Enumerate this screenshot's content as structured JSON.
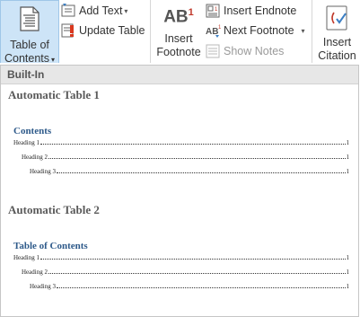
{
  "ribbon": {
    "toc_button": {
      "line1": "Table of",
      "line2": "Contents",
      "arrow": "▾",
      "icon": "document-lines-icon"
    },
    "add_text": {
      "label": "Add Text",
      "arrow": "▾",
      "icon": "add-text-icon"
    },
    "update_table": {
      "label": "Update Table",
      "icon": "update-table-icon"
    },
    "insert_footnote": {
      "line1": "Insert",
      "line2": "Footnote",
      "glyph": "AB",
      "sup": "1",
      "icon": "footnote-icon"
    },
    "insert_endnote": {
      "label": "Insert Endnote",
      "icon": "endnote-icon"
    },
    "next_footnote": {
      "label": "Next Footnote",
      "arrow": "▾",
      "icon": "next-footnote-icon"
    },
    "show_notes": {
      "label": "Show Notes",
      "enabled": false,
      "icon": "show-notes-icon"
    },
    "insert_citation": {
      "line1": "Insert",
      "line2": "Citation",
      "icon": "citation-icon"
    }
  },
  "gallery": {
    "section_label": "Built-In",
    "items": [
      {
        "title": "Automatic Table 1",
        "heading": "Contents",
        "entries": [
          {
            "text": "Heading 1",
            "page": "1"
          },
          {
            "text": "Heading 2",
            "page": "1"
          },
          {
            "text": "Heading 3",
            "page": "1"
          }
        ]
      },
      {
        "title": "Automatic Table 2",
        "heading": "Table of Contents",
        "entries": [
          {
            "text": "Heading 1",
            "page": "1"
          },
          {
            "text": "Heading 2",
            "page": "1"
          },
          {
            "text": "Heading 3",
            "page": "1"
          }
        ]
      }
    ]
  },
  "colors": {
    "accent_blue": "#2e5a8a",
    "selected_bg": "#cde4f7",
    "header_bg": "#e7e7e7",
    "footnote_red": "#c0392b"
  }
}
